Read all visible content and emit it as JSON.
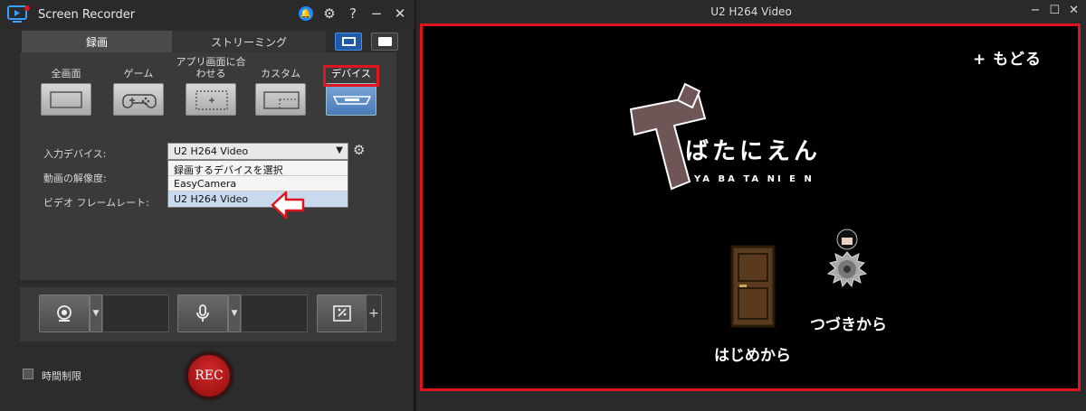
{
  "recorder": {
    "title": "Screen Recorder",
    "tabs": [
      "録画",
      "ストリーミング"
    ],
    "capture_modes": [
      {
        "label": "全画面",
        "icon": "fullscreen-icon"
      },
      {
        "label": "ゲーム",
        "icon": "gamepad-icon"
      },
      {
        "label": "アプリ画面に合\nわせる",
        "icon": "app-window-icon"
      },
      {
        "label": "カスタム",
        "icon": "custom-area-icon"
      },
      {
        "label": "デバイス",
        "icon": "device-icon",
        "selected": true
      }
    ],
    "settings": {
      "input_device_label": "入力デバイス:",
      "resolution_label": "動画の解像度:",
      "framerate_label": "ビデオ フレームレート:",
      "selected_device": "U2 H264 Video",
      "dropdown_options": [
        "録画するデバイスを選択",
        "EasyCamera",
        "U2 H264 Video"
      ]
    },
    "time_limit_label": "時間制限",
    "rec_label": "REC",
    "plus_label": "+"
  },
  "video": {
    "title": "U2 H264 Video",
    "back_label": "+ もどる",
    "logo_main": "ばたにえん",
    "logo_romaji": "YA BA TA NI E N",
    "start_label": "はじめから",
    "continue_label": "つづきから"
  },
  "colors": {
    "annotation_red": "#e0141e",
    "selected_blue": "#4a7bb8"
  }
}
